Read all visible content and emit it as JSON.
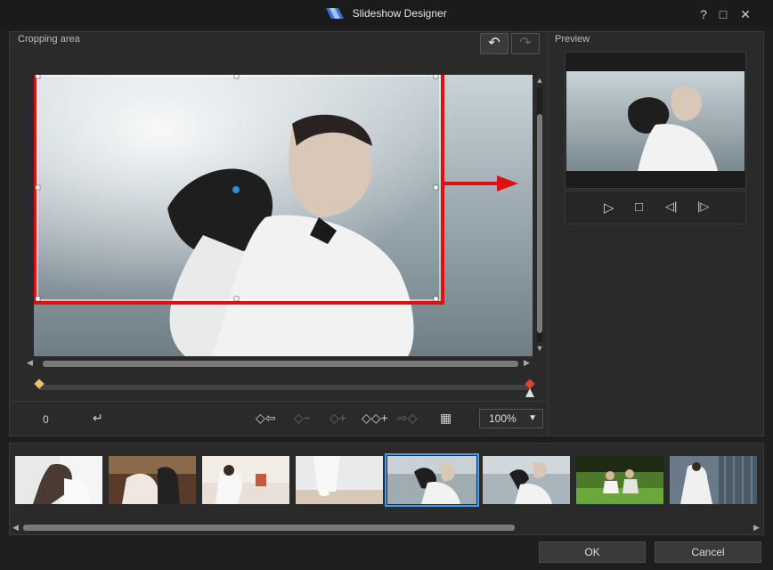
{
  "window": {
    "title": "Slideshow Designer"
  },
  "colors": {
    "accent": "#3aa0ff",
    "crop_frame": "#e01010",
    "arrow": "#e01010"
  },
  "icons": {
    "help": "?",
    "maximize": "□",
    "close": "✕",
    "undo": "↶",
    "redo": "↷",
    "scroll_up": "▲",
    "scroll_down": "▼",
    "scroll_left": "◀",
    "scroll_right": "▶",
    "caret_down": "▼",
    "enter": "↵",
    "play": "▷",
    "stop": "□",
    "prev_frame": "◁|",
    "next_frame": "|▷",
    "kf_prev": "◇⇦",
    "kf_remove": "◇−",
    "kf_add": "◇+",
    "kf_add_dup": "◇◇+",
    "kf_next": "⇨◇",
    "fit": "▦"
  },
  "crop": {
    "section_label": "Cropping area"
  },
  "preview": {
    "section_label": "Preview"
  },
  "toolbar": {
    "position_value": "0",
    "zoom": "100%"
  },
  "thumbnails": [
    "slide-1",
    "slide-2",
    "slide-3",
    "slide-4",
    "slide-5",
    "slide-6",
    "slide-7",
    "slide-8"
  ],
  "footer": {
    "ok_label": "OK",
    "cancel_label": "Cancel"
  }
}
